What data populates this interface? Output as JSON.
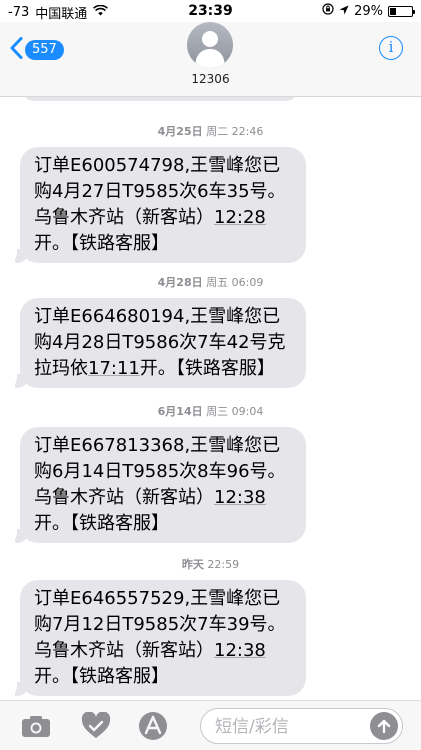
{
  "status_bar": {
    "signal": "-73",
    "carrier": "中国联通",
    "time": "23:39",
    "battery_percent": "29%",
    "battery_level": 0.29
  },
  "header": {
    "back_count": "557",
    "contact_name": "12306",
    "info_label": "i"
  },
  "messages": [
    {
      "date": "4月25日",
      "weekday_time": "周二 22:46",
      "text_pre": "订单E600574798,王雪峰您已购4月27日T9585次6车35号。乌鲁木齐站（新客站）",
      "time_link": "12:28",
      "text_post": "开。【铁路客服】"
    },
    {
      "date": "4月28日",
      "weekday_time": "周五 06:09",
      "text_pre": "订单E664680194,王雪峰您已购4月28日T9586次7车42号克拉玛依",
      "time_link": "17:11",
      "text_post": "开。【铁路客服】"
    },
    {
      "date": "6月14日",
      "weekday_time": "周三 09:04",
      "text_pre": "订单E667813368,王雪峰您已购6月14日T9585次8车96号。乌鲁木齐站（新客站）",
      "time_link": "12:38",
      "text_post": "开。【铁路客服】"
    },
    {
      "date": "昨天",
      "weekday_time": "22:59",
      "text_pre": "订单E646557529,王雪峰您已购7月12日T9585次7车39号。乌鲁木齐站（新客站）",
      "time_link": "12:38",
      "text_post": "开。【铁路客服】"
    }
  ],
  "input_bar": {
    "placeholder": "短信/彩信",
    "icons": [
      "camera-icon",
      "digital-touch-heart-icon",
      "app-store-icon",
      "send-arrow-icon"
    ]
  },
  "colors": {
    "accent": "#1a8cff",
    "bubble": "#e5e5ea",
    "timestamp": "#8e8e93"
  }
}
